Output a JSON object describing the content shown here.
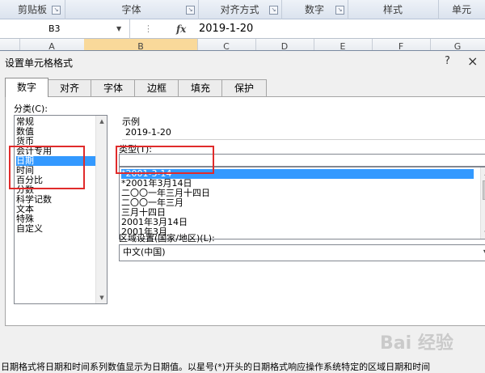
{
  "ribbon": {
    "groups": [
      "剪贴板",
      "字体",
      "对齐方式",
      "数字",
      "样式",
      "单元"
    ]
  },
  "formula_bar": {
    "name_box": "B3",
    "fx": "fx",
    "value": "2019-1-20"
  },
  "columns": [
    "A",
    "B",
    "C",
    "D",
    "E",
    "F",
    "G"
  ],
  "dialog": {
    "title": "设置单元格格式",
    "help": "?",
    "close": "×",
    "tabs": [
      "数字",
      "对齐",
      "字体",
      "边框",
      "填充",
      "保护"
    ],
    "active_tab": "数字",
    "category_label": "分类(C):",
    "categories": [
      "常规",
      "数值",
      "货币",
      "会计专用",
      "日期",
      "时间",
      "百分比",
      "分数",
      "科学记数",
      "文本",
      "特殊",
      "自定义"
    ],
    "selected_category": "日期",
    "sample_label": "示例",
    "sample_value": "2019-1-20",
    "type_label": "类型(T):",
    "types": [
      "*2001-3-14",
      "*2001年3月14日",
      "二〇〇一年三月十四日",
      "二〇〇一年三月",
      "三月十四日",
      "2001年3月14日",
      "2001年3月"
    ],
    "selected_type": "*2001-3-14",
    "locale_label": "区域设置(国家/地区)(L):",
    "locale_value": "中文(中国)",
    "description": "日期格式将日期和时间系列数值显示为日期值。以星号(*)开头的日期格式响应操作系统特定的区域日期和时间"
  },
  "watermark": "Bai 经验",
  "colors": {
    "selection": "#3399ff",
    "highlight_box": "#e02b2b"
  }
}
